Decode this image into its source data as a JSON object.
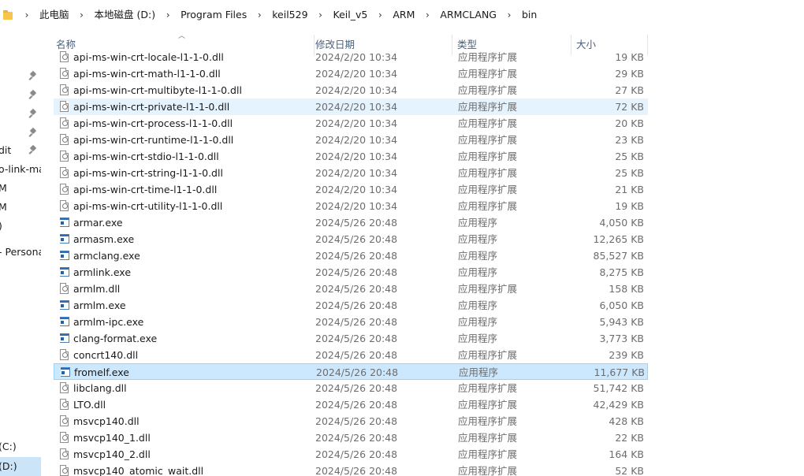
{
  "address": {
    "segments": [
      "此电脑",
      "本地磁盘 (D:)",
      "Program Files",
      "keil529",
      "Keil_v5",
      "ARM",
      "ARMCLANG",
      "bin"
    ]
  },
  "nav": {
    "items": [
      {
        "label": "dit"
      },
      {
        "label": "o-link-ma"
      },
      {
        "label": "M"
      },
      {
        "label": "M"
      },
      {
        "label": ")"
      },
      {
        "label": "- Persona"
      },
      {
        "label": "(C:)"
      },
      {
        "label": "(D:)"
      }
    ]
  },
  "columns": {
    "name": "名称",
    "date": "修改日期",
    "type": "类型",
    "size": "大小"
  },
  "files": [
    {
      "name": "api-ms-win-crt-locale-l1-1-0.dll",
      "date": "2024/2/20 10:34",
      "type": "应用程序扩展",
      "size": "19 KB",
      "icon": "dll-icon"
    },
    {
      "name": "api-ms-win-crt-math-l1-1-0.dll",
      "date": "2024/2/20 10:34",
      "type": "应用程序扩展",
      "size": "29 KB",
      "icon": "dll-icon"
    },
    {
      "name": "api-ms-win-crt-multibyte-l1-1-0.dll",
      "date": "2024/2/20 10:34",
      "type": "应用程序扩展",
      "size": "27 KB",
      "icon": "dll-icon"
    },
    {
      "name": "api-ms-win-crt-private-l1-1-0.dll",
      "date": "2024/2/20 10:34",
      "type": "应用程序扩展",
      "size": "72 KB",
      "icon": "dll-icon",
      "state": "hover"
    },
    {
      "name": "api-ms-win-crt-process-l1-1-0.dll",
      "date": "2024/2/20 10:34",
      "type": "应用程序扩展",
      "size": "20 KB",
      "icon": "dll-icon"
    },
    {
      "name": "api-ms-win-crt-runtime-l1-1-0.dll",
      "date": "2024/2/20 10:34",
      "type": "应用程序扩展",
      "size": "23 KB",
      "icon": "dll-icon"
    },
    {
      "name": "api-ms-win-crt-stdio-l1-1-0.dll",
      "date": "2024/2/20 10:34",
      "type": "应用程序扩展",
      "size": "25 KB",
      "icon": "dll-icon"
    },
    {
      "name": "api-ms-win-crt-string-l1-1-0.dll",
      "date": "2024/2/20 10:34",
      "type": "应用程序扩展",
      "size": "25 KB",
      "icon": "dll-icon"
    },
    {
      "name": "api-ms-win-crt-time-l1-1-0.dll",
      "date": "2024/2/20 10:34",
      "type": "应用程序扩展",
      "size": "21 KB",
      "icon": "dll-icon"
    },
    {
      "name": "api-ms-win-crt-utility-l1-1-0.dll",
      "date": "2024/2/20 10:34",
      "type": "应用程序扩展",
      "size": "19 KB",
      "icon": "dll-icon"
    },
    {
      "name": "armar.exe",
      "date": "2024/5/26 20:48",
      "type": "应用程序",
      "size": "4,050 KB",
      "icon": "exe-icon"
    },
    {
      "name": "armasm.exe",
      "date": "2024/5/26 20:48",
      "type": "应用程序",
      "size": "12,265 KB",
      "icon": "exe-icon"
    },
    {
      "name": "armclang.exe",
      "date": "2024/5/26 20:48",
      "type": "应用程序",
      "size": "85,527 KB",
      "icon": "exe-icon"
    },
    {
      "name": "armlink.exe",
      "date": "2024/5/26 20:48",
      "type": "应用程序",
      "size": "8,275 KB",
      "icon": "exe-icon"
    },
    {
      "name": "armlm.dll",
      "date": "2024/5/26 20:48",
      "type": "应用程序扩展",
      "size": "158 KB",
      "icon": "dll-icon"
    },
    {
      "name": "armlm.exe",
      "date": "2024/5/26 20:48",
      "type": "应用程序",
      "size": "6,050 KB",
      "icon": "exe-icon"
    },
    {
      "name": "armlm-ipc.exe",
      "date": "2024/5/26 20:48",
      "type": "应用程序",
      "size": "5,943 KB",
      "icon": "exe-icon"
    },
    {
      "name": "clang-format.exe",
      "date": "2024/5/26 20:48",
      "type": "应用程序",
      "size": "3,773 KB",
      "icon": "exe-icon"
    },
    {
      "name": "concrt140.dll",
      "date": "2024/5/26 20:48",
      "type": "应用程序扩展",
      "size": "239 KB",
      "icon": "dll-icon"
    },
    {
      "name": "fromelf.exe",
      "date": "2024/5/26 20:48",
      "type": "应用程序",
      "size": "11,677 KB",
      "icon": "exe-icon",
      "state": "selected"
    },
    {
      "name": "libclang.dll",
      "date": "2024/5/26 20:48",
      "type": "应用程序扩展",
      "size": "51,742 KB",
      "icon": "dll-icon"
    },
    {
      "name": "LTO.dll",
      "date": "2024/5/26 20:48",
      "type": "应用程序扩展",
      "size": "42,429 KB",
      "icon": "dll-icon"
    },
    {
      "name": "msvcp140.dll",
      "date": "2024/5/26 20:48",
      "type": "应用程序扩展",
      "size": "428 KB",
      "icon": "dll-icon"
    },
    {
      "name": "msvcp140_1.dll",
      "date": "2024/5/26 20:48",
      "type": "应用程序扩展",
      "size": "22 KB",
      "icon": "dll-icon"
    },
    {
      "name": "msvcp140_2.dll",
      "date": "2024/5/26 20:48",
      "type": "应用程序扩展",
      "size": "164 KB",
      "icon": "dll-icon"
    },
    {
      "name": "msvcp140_atomic_wait.dll",
      "date": "2024/5/26 20:48",
      "type": "应用程序扩展",
      "size": "52 KB",
      "icon": "dll-icon"
    }
  ],
  "colors": {
    "selected_bg": "#cce8ff",
    "hover_bg": "#e5f3ff",
    "header_text": "#4c607a"
  }
}
